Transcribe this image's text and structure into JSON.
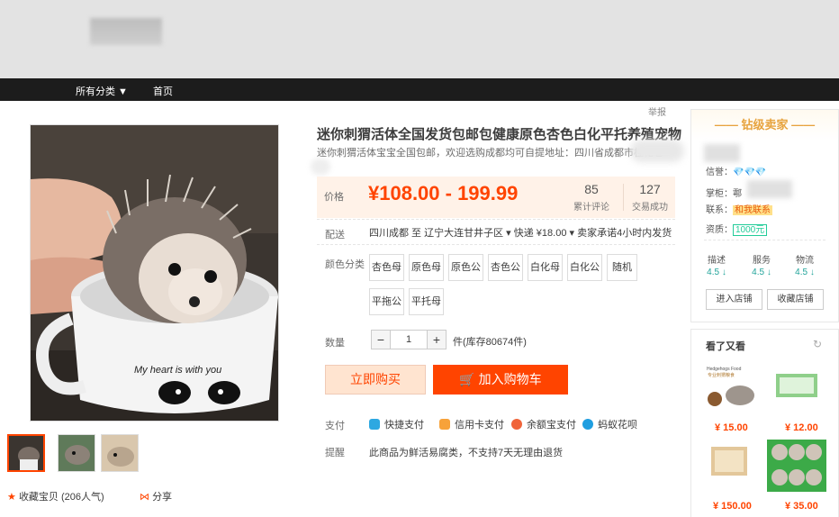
{
  "nav": {
    "category_label": "所有分类 ▼",
    "home": "首页"
  },
  "report": "举报",
  "product": {
    "title": "迷你刺猬活体全国发货包邮包健康原色杏色白化平托养殖宠物",
    "subtitle": "迷你刺猬活体宝宝全国包邮，欢迎选购成都均可自提地址：四川省成都市桂花巷",
    "price_label": "价格",
    "price": "¥108.00 - 199.99",
    "reviews_count": "85",
    "reviews_label": "累计评论",
    "sales_count": "127",
    "sales_label": "交易成功",
    "ship_label": "配送",
    "ship_text": "四川成都 至  辽宁大连甘井子区 ▾   快递 ¥18.00 ▾   卖家承诺4小时内发货",
    "color_label": "颜色分类",
    "skus": [
      "杏色母",
      "原色母",
      "原色公",
      "杏色公",
      "白化母",
      "白化公",
      "随机",
      "平拖公",
      "平托母"
    ],
    "qty_label": "数量",
    "qty_minus": "−",
    "qty_value": "1",
    "qty_plus": "+",
    "stock": "件(库存80674件)",
    "buy_now": "立即购买",
    "add_cart": "加入购物车",
    "pay_label": "支付",
    "pay_methods": [
      "快捷支付",
      "信用卡支付",
      "余额宝支付",
      "蚂蚁花呗"
    ],
    "notice_label": "提醒",
    "notice_text": "此商品为鲜活易腐类，不支持7天无理由退货",
    "fav": "收藏宝贝 (206人气)",
    "share": "分享",
    "mug_text": "My heart is with you"
  },
  "seller": {
    "badge": "钻级卖家",
    "credit_label": "信誉：",
    "credit_value": "💎💎💎",
    "shopkeeper_label": "掌柜：",
    "shopkeeper_prefix": "鄠",
    "contact_label": "联系：",
    "contact_value": "和我联系",
    "qual_label": "资质：",
    "qual_value": "1000元",
    "scores": [
      {
        "label": "描述",
        "value": "4.5 ↓"
      },
      {
        "label": "服务",
        "value": "4.5 ↓"
      },
      {
        "label": "物流",
        "value": "4.5 ↓"
      }
    ],
    "enter_store": "进入店铺",
    "fav_store": "收藏店铺"
  },
  "recommend": {
    "title": "看了又看",
    "items": [
      {
        "price": "¥ 15.00",
        "img_text": "Hedgehogs Food 专业刺猬粮食"
      },
      {
        "price": "¥ 12.00"
      },
      {
        "price": "¥ 150.00"
      },
      {
        "price": "¥ 35.00"
      }
    ]
  },
  "colors": {
    "accent": "#ff4400",
    "nav_bg": "#1c1c1c",
    "price_bg": "#fff2e8",
    "gold": "#e7a33e"
  }
}
